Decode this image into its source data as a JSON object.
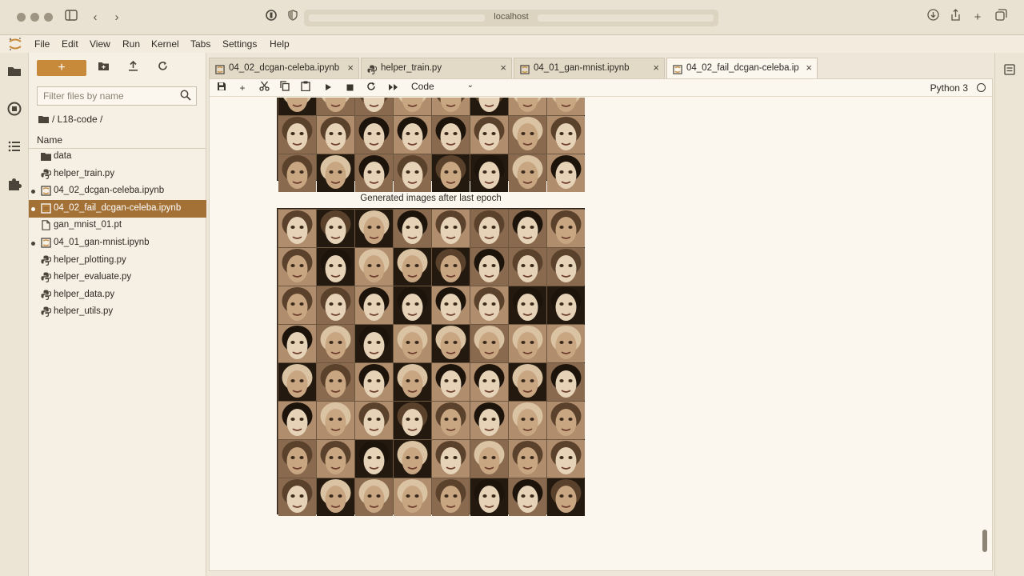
{
  "browser": {
    "url": "localhost"
  },
  "menu": [
    "File",
    "Edit",
    "View",
    "Run",
    "Kernel",
    "Tabs",
    "Settings",
    "Help"
  ],
  "filebrowser": {
    "new_label": "+",
    "filter_placeholder": "Filter files by name",
    "breadcrumb": "/ L18-code /",
    "column_name": "Name",
    "files": [
      {
        "name": "data",
        "icon": "folder-icon",
        "running": false,
        "selected": false
      },
      {
        "name": "helper_train.py",
        "icon": "python-file-icon",
        "running": false,
        "selected": false
      },
      {
        "name": "04_02_dcgan-celeba.ipynb",
        "icon": "notebook-icon",
        "running": true,
        "selected": false
      },
      {
        "name": "04_02_fail_dcgan-celeba.ipynb",
        "icon": "notebook-icon",
        "running": true,
        "selected": true
      },
      {
        "name": "gan_mnist_01.pt",
        "icon": "file-icon",
        "running": false,
        "selected": false
      },
      {
        "name": "04_01_gan-mnist.ipynb",
        "icon": "notebook-icon",
        "running": true,
        "selected": false
      },
      {
        "name": "helper_plotting.py",
        "icon": "python-file-icon",
        "running": false,
        "selected": false
      },
      {
        "name": "helper_evaluate.py",
        "icon": "python-file-icon",
        "running": false,
        "selected": false
      },
      {
        "name": "helper_data.py",
        "icon": "python-file-icon",
        "running": false,
        "selected": false
      },
      {
        "name": "helper_utils.py",
        "icon": "python-file-icon",
        "running": false,
        "selected": false
      }
    ]
  },
  "tabs": [
    {
      "label": "04_02_dcgan-celeba.ipynb",
      "icon": "notebook-icon",
      "active": false
    },
    {
      "label": "helper_train.py",
      "icon": "python-file-icon",
      "active": false
    },
    {
      "label": "04_01_gan-mnist.ipynb",
      "icon": "notebook-icon",
      "active": false
    },
    {
      "label": "04_02_fail_dcgan-celeba.ip",
      "icon": "notebook-icon",
      "active": true
    }
  ],
  "notebook": {
    "cell_type": "Code",
    "kernel": "Python 3",
    "output_title": "Generated images after last epoch"
  },
  "colors": {
    "accent": "#c78a3a",
    "selected_row": "#a37136"
  }
}
